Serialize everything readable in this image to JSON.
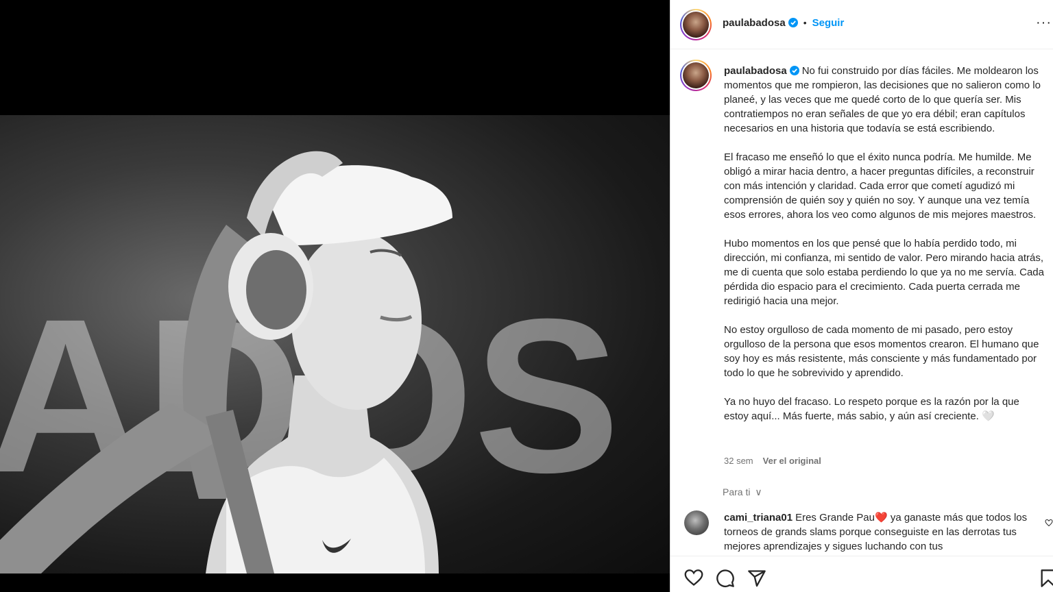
{
  "header": {
    "username": "paulabadosa",
    "separator": "•",
    "follow_label": "Seguir",
    "more_label": "···"
  },
  "caption": {
    "username": "paulabadosa",
    "paragraphs": [
      "No fui construido por días fáciles. Me moldearon los momentos que me rompieron, las decisiones que no salieron como lo planeé, y las veces que me quedé corto de lo que quería ser. Mis contratiempos no eran señales de que yo era débil; eran capítulos necesarios en una historia que todavía se está escribiendo.",
      "El fracaso me enseñó lo que el éxito nunca podría. Me humilde. Me obligó a mirar hacia dentro, a hacer preguntas difíciles, a reconstruir con más intención y claridad. Cada error que cometí agudizó mi comprensión de quién soy y quién no soy. Y aunque una vez temía esos errores, ahora los veo como algunos de mis mejores maestros.",
      "Hubo momentos en los que pensé que lo había perdido todo, mi dirección, mi confianza, mi sentido de valor. Pero mirando hacia atrás, me di cuenta que solo estaba perdiendo lo que ya no me servía. Cada pérdida dio espacio para el crecimiento. Cada puerta cerrada me redirigió hacia una mejor.",
      "No estoy orgulloso de cada momento de mi pasado, pero estoy orgulloso de la persona que esos momentos crearon. El humano que soy hoy es más resistente, más consciente y más fundamentado por todo lo que he sobrevivido y aprendido.",
      "Ya no huyo del fracaso. Lo respeto porque es la razón por la que estoy aquí... Más fuerte, más sabio, y aún así creciente. 🤍"
    ],
    "time_ago": "32 sem",
    "see_original": "Ver el original"
  },
  "comments_filter": {
    "label": "Para ti",
    "chevron": "∨"
  },
  "comments": [
    {
      "username": "cami_triana01",
      "text": "Eres Grande Pau❤️ ya ganaste más que todos los torneos de grands slams porque conseguiste en las derrotas tus mejores aprendizajes y sigues luchando con tus"
    }
  ],
  "icons": {
    "like": "heart-icon",
    "comment": "comment-icon",
    "share": "send-icon",
    "save": "bookmark-icon"
  },
  "colors": {
    "accent": "#0095f6",
    "verified": "#0095f6",
    "text": "#262626",
    "muted": "#737373"
  }
}
